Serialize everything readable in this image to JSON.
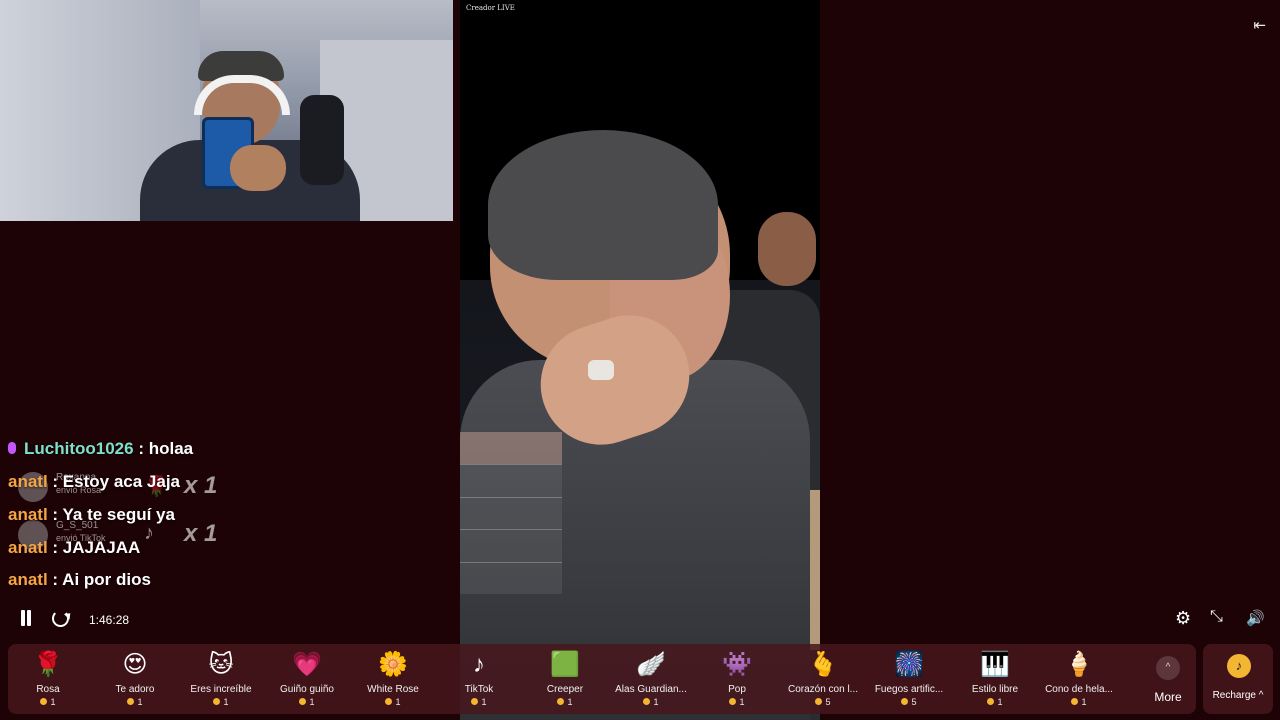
{
  "video": {
    "creator_badge": "Creador LIVE",
    "collapse_icon": "collapse-panel-icon"
  },
  "chat": {
    "messages": [
      {
        "user": "Luchitoo1026",
        "text": ": holaa"
      },
      {
        "user": "anatl",
        "text": ": Estoy aca Jaja"
      },
      {
        "user": "anatl",
        "text": ": Ya te seguí ya"
      },
      {
        "user": "anatl",
        "text": ": JAJAJAA"
      },
      {
        "user": "anatl",
        "text": ": Ai por dios"
      }
    ],
    "gift_notices": [
      {
        "sender": "Roxanna",
        "sent": "envió Rosa",
        "icon": "🌹",
        "count": "x 1"
      },
      {
        "sender": "G_S_501",
        "sent": "envió TikTok",
        "icon": "♪",
        "count": "x 1"
      }
    ]
  },
  "controls": {
    "timecode": "1:46:28",
    "pause_icon": "pause-icon",
    "replay_icon": "replay-icon",
    "settings_icon": "⚙",
    "fullscreen_icon": "⤡",
    "volume_icon": "🔊"
  },
  "gifts": [
    {
      "label": "Rosa",
      "price": "1",
      "icon": "🌹"
    },
    {
      "label": "Te adoro",
      "price": "1",
      "icon": "😍"
    },
    {
      "label": "Eres increíble",
      "price": "1",
      "icon": "🐱"
    },
    {
      "label": "Guiño guiño",
      "price": "1",
      "icon": "💗"
    },
    {
      "label": "White Rose",
      "price": "1",
      "icon": "🌼"
    },
    {
      "label": "TikTok",
      "price": "1",
      "icon": "♪"
    },
    {
      "label": "Creeper",
      "price": "1",
      "icon": "🟩"
    },
    {
      "label": "Alas Guardian...",
      "price": "1",
      "icon": "🪽"
    },
    {
      "label": "Pop",
      "price": "1",
      "icon": "👾"
    },
    {
      "label": "Corazón con l...",
      "price": "5",
      "icon": "🫰"
    },
    {
      "label": "Fuegos artific...",
      "price": "5",
      "icon": "🎆"
    },
    {
      "label": "Estilo libre",
      "price": "1",
      "icon": "🎹"
    },
    {
      "label": "Cono de hela...",
      "price": "1",
      "icon": "🍦"
    }
  ],
  "more": {
    "label": "More",
    "icon": "^"
  },
  "recharge": {
    "label": "Recharge ^",
    "icon": "♪"
  },
  "colors": {
    "background": "#1d0306",
    "username": "#f6a545",
    "accent_username": "#7fe0c9",
    "coin": "#f3b632"
  }
}
